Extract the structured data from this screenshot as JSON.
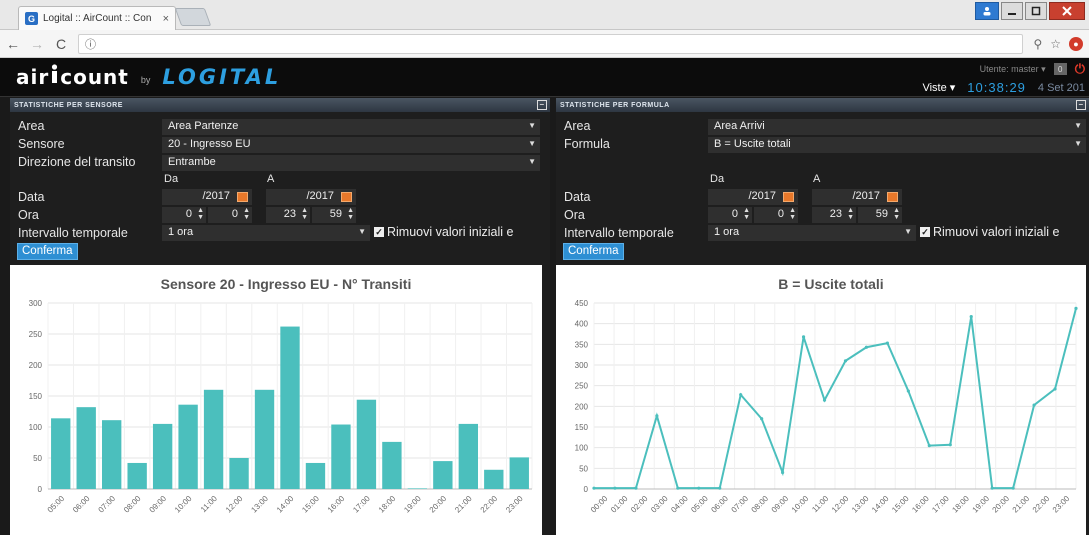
{
  "browser": {
    "tab_title": "Logital :: AirCount :: Con",
    "tab_favicon": "G",
    "tab_close": "×",
    "url": "ⓘ",
    "window_user_icon": "user-icon",
    "nav_back": "←",
    "nav_forward": "→",
    "nav_reload": "C",
    "key_icon": "⚲",
    "star_icon": "☆"
  },
  "app": {
    "logo_air": "air",
    "logo_count": "count",
    "logo_by": "by",
    "logo_logital": "LOGITAL",
    "user_label": "Utente: master ▾",
    "user_badge": "0",
    "viste_label": "Viste ▾",
    "clock": "10:38:29",
    "date": "4 Set 201"
  },
  "left_panel": {
    "title": "STATISTICHE PER SENSORE",
    "area_label": "Area",
    "area_value": "Area Partenze",
    "sensor_label": "Sensore",
    "sensor_value": "20 - Ingresso EU",
    "direction_label": "Direzione del transito",
    "direction_value": "Entrambe",
    "da_label": "Da",
    "a_label": "A",
    "data_label": "Data",
    "date_from": "/2017",
    "date_to": "/2017",
    "ora_label": "Ora",
    "hour_from": "0",
    "min_from": "0",
    "hour_to": "23",
    "min_to": "59",
    "interval_label": "Intervallo temporale",
    "interval_value": "1 ora",
    "remove_label": "Rimuovi valori iniziali e",
    "confirm_label": "Conferma"
  },
  "right_panel": {
    "title": "STATISTICHE PER FORMULA",
    "area_label": "Area",
    "area_value": "Area Arrivi",
    "formula_label": "Formula",
    "formula_value": "B = Uscite totali",
    "da_label": "Da",
    "a_label": "A",
    "data_label": "Data",
    "date_from": "/2017",
    "date_to": "/2017",
    "ora_label": "Ora",
    "hour_from": "0",
    "min_from": "0",
    "hour_to": "23",
    "min_to": "59",
    "interval_label": "Intervallo temporale",
    "interval_value": "1 ora",
    "remove_label": "Rimuovi valori iniziali e",
    "confirm_label": "Conferma"
  },
  "colors": {
    "accent": "#2e8fd3",
    "series": "#4bbfbd",
    "logo": "#2d9fe0"
  },
  "chart_data": [
    {
      "type": "bar",
      "title": "Sensore 20 - Ingresso EU - N° Transiti",
      "categories": [
        "05:00",
        "06:00",
        "07:00",
        "08:00",
        "09:00",
        "10:00",
        "11:00",
        "12:00",
        "13:00",
        "14:00",
        "15:00",
        "16:00",
        "17:00",
        "18:00",
        "19:00",
        "20:00",
        "21:00",
        "22:00",
        "23:00"
      ],
      "values": [
        114,
        132,
        111,
        42,
        105,
        136,
        160,
        50,
        160,
        262,
        42,
        104,
        144,
        76,
        1,
        45,
        105,
        31,
        51
      ],
      "ylim": [
        0,
        300
      ],
      "yticks": [
        0,
        50,
        100,
        150,
        200,
        250,
        300
      ],
      "grid": true
    },
    {
      "type": "line",
      "title": "B = Uscite totali",
      "categories": [
        "00:00",
        "01:00",
        "02:00",
        "03:00",
        "04:00",
        "05:00",
        "06:00",
        "07:00",
        "08:00",
        "09:00",
        "10:00",
        "11:00",
        "12:00",
        "13:00",
        "14:00",
        "15:00",
        "16:00",
        "17:00",
        "18:00",
        "19:00",
        "20:00",
        "21:00",
        "22:00",
        "23:00"
      ],
      "values": [
        2,
        2,
        2,
        177,
        2,
        2,
        2,
        228,
        170,
        40,
        368,
        215,
        310,
        343,
        353,
        237,
        105,
        107,
        417,
        2,
        2,
        203,
        242,
        437
      ],
      "ylim": [
        0,
        450
      ],
      "yticks": [
        0,
        50,
        100,
        150,
        200,
        250,
        300,
        350,
        400,
        450
      ],
      "grid": true
    }
  ]
}
